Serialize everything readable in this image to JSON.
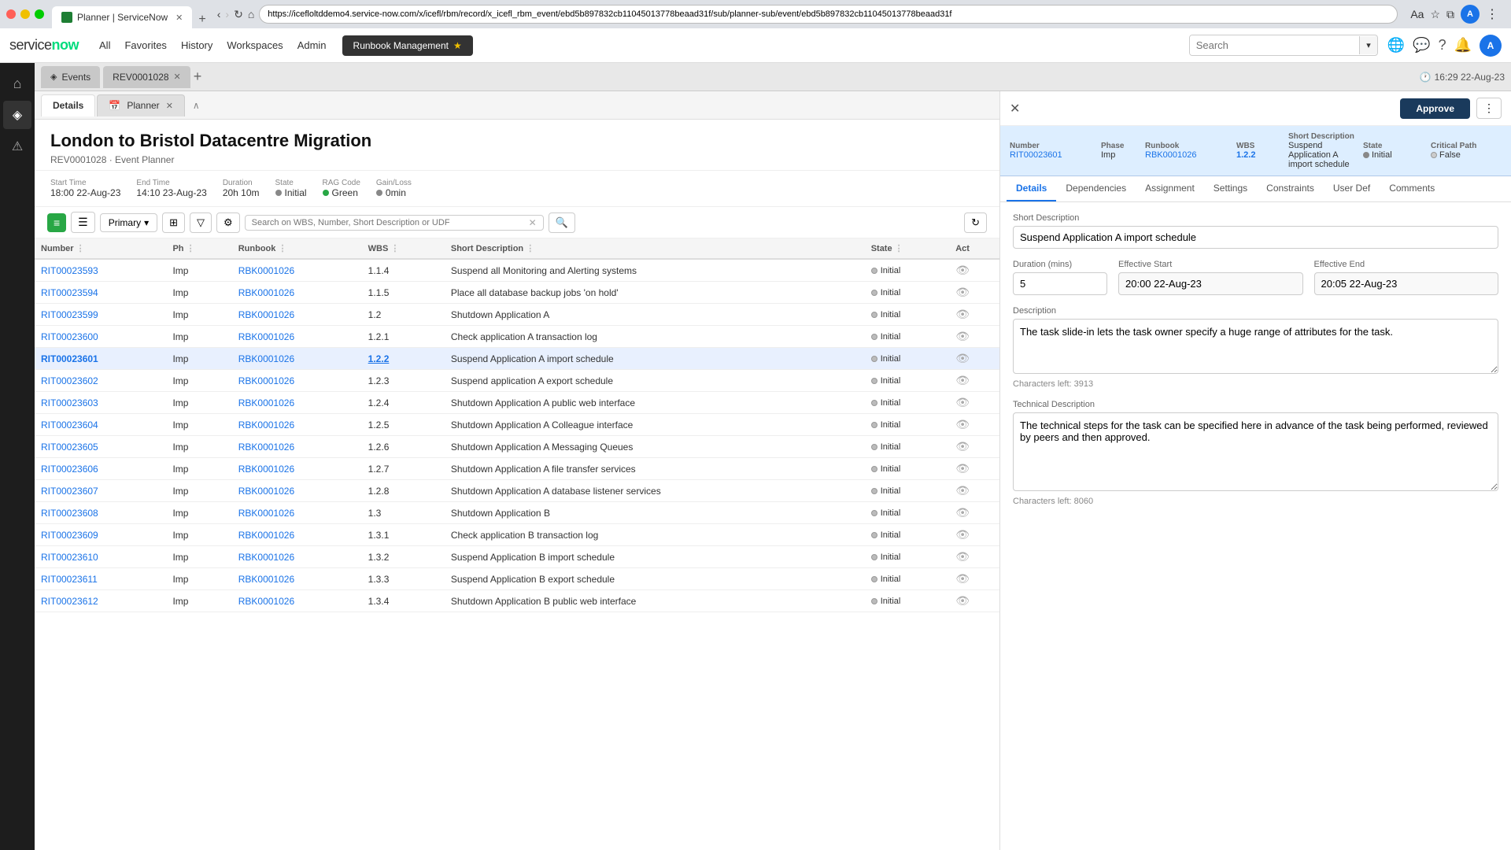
{
  "browser": {
    "tab_label": "Planner | ServiceNow",
    "address": "https://icefloltddemo4.service-now.com/x/icefl/rbm/record/x_icefl_rbm_event/ebd5b897832cb11045013778beaad31f/sub/planner-sub/event/ebd5b897832cb11045013778beaad31f",
    "new_tab_label": "+",
    "minimize": "—",
    "maximize": "□",
    "close": "✕"
  },
  "header": {
    "logo": "servicenow",
    "nav_items": [
      "All",
      "Favorites",
      "History",
      "Workspaces",
      "Admin"
    ],
    "runbook_btn": "Runbook Management",
    "search_placeholder": "Search",
    "clock_icon": "🕐",
    "datetime": "16:29 22-Aug-23"
  },
  "left_sidebar": {
    "icons": [
      {
        "name": "home-icon",
        "symbol": "⌂",
        "active": false
      },
      {
        "name": "tag-icon",
        "symbol": "◈",
        "active": true
      },
      {
        "name": "alert-icon",
        "symbol": "⚠",
        "active": false
      }
    ]
  },
  "tabs": {
    "items": [
      {
        "label": "Events",
        "closeable": false,
        "active": false
      },
      {
        "label": "REV0001028",
        "closeable": true,
        "active": true
      }
    ],
    "add_label": "+"
  },
  "content_tabs": {
    "items": [
      {
        "label": "Details",
        "active": true
      },
      {
        "label": "Planner",
        "closeable": true,
        "active": false
      }
    ]
  },
  "page": {
    "title": "London to Bristol Datacentre Migration",
    "subtitle": "REV0001028 · Event Planner",
    "meta": {
      "start_time_label": "Start Time",
      "start_time": "18:00 22-Aug-23",
      "end_time_label": "End Time",
      "end_time": "14:10 23-Aug-23",
      "duration_label": "Duration",
      "duration": "20h 10m",
      "state_label": "State",
      "state": "Initial",
      "rag_label": "RAG Code",
      "rag": "Green",
      "gain_loss_label": "Gain/Loss",
      "gain_loss": "0min"
    }
  },
  "toolbar": {
    "primary_label": "Primary",
    "search_placeholder": "Search on WBS, Number, Short Description or UDF",
    "refresh_title": "Refresh"
  },
  "table": {
    "columns": [
      "Number",
      "Ph",
      "Runbook",
      "WBS",
      "Short Description",
      "State",
      "Act"
    ],
    "rows": [
      {
        "number": "RIT00023593",
        "ph": "Imp",
        "runbook": "RBK0001026",
        "wbs": "1.1.4",
        "desc": "Suspend all Monitoring and Alerting systems",
        "state": "Initial",
        "selected": false
      },
      {
        "number": "RIT00023594",
        "ph": "Imp",
        "runbook": "RBK0001026",
        "wbs": "1.1.5",
        "desc": "Place all database backup jobs 'on hold'",
        "state": "Initial",
        "selected": false
      },
      {
        "number": "RIT00023599",
        "ph": "Imp",
        "runbook": "RBK0001026",
        "wbs": "1.2",
        "desc": "Shutdown Application A",
        "state": "Initial",
        "selected": false
      },
      {
        "number": "RIT00023600",
        "ph": "Imp",
        "runbook": "RBK0001026",
        "wbs": "1.2.1",
        "desc": "Check application A transaction log",
        "state": "Initial",
        "selected": false
      },
      {
        "number": "RIT00023601",
        "ph": "Imp",
        "runbook": "RBK0001026",
        "wbs": "1.2.2",
        "desc": "Suspend Application A import schedule",
        "state": "Initial",
        "selected": true
      },
      {
        "number": "RIT00023602",
        "ph": "Imp",
        "runbook": "RBK0001026",
        "wbs": "1.2.3",
        "desc": "Suspend application A export schedule",
        "state": "Initial",
        "selected": false
      },
      {
        "number": "RIT00023603",
        "ph": "Imp",
        "runbook": "RBK0001026",
        "wbs": "1.2.4",
        "desc": "Shutdown Application A public web interface",
        "state": "Initial",
        "selected": false
      },
      {
        "number": "RIT00023604",
        "ph": "Imp",
        "runbook": "RBK0001026",
        "wbs": "1.2.5",
        "desc": "Shutdown Application A Colleague interface",
        "state": "Initial",
        "selected": false
      },
      {
        "number": "RIT00023605",
        "ph": "Imp",
        "runbook": "RBK0001026",
        "wbs": "1.2.6",
        "desc": "Shutdown Application A Messaging Queues",
        "state": "Initial",
        "selected": false
      },
      {
        "number": "RIT00023606",
        "ph": "Imp",
        "runbook": "RBK0001026",
        "wbs": "1.2.7",
        "desc": "Shutdown Application A file transfer services",
        "state": "Initial",
        "selected": false
      },
      {
        "number": "RIT00023607",
        "ph": "Imp",
        "runbook": "RBK0001026",
        "wbs": "1.2.8",
        "desc": "Shutdown Application A database listener services",
        "state": "Initial",
        "selected": false
      },
      {
        "number": "RIT00023608",
        "ph": "Imp",
        "runbook": "RBK0001026",
        "wbs": "1.3",
        "desc": "Shutdown Application B",
        "state": "Initial",
        "selected": false
      },
      {
        "number": "RIT00023609",
        "ph": "Imp",
        "runbook": "RBK0001026",
        "wbs": "1.3.1",
        "desc": "Check application B transaction log",
        "state": "Initial",
        "selected": false
      },
      {
        "number": "RIT00023610",
        "ph": "Imp",
        "runbook": "RBK0001026",
        "wbs": "1.3.2",
        "desc": "Suspend Application B import schedule",
        "state": "Initial",
        "selected": false
      },
      {
        "number": "RIT00023611",
        "ph": "Imp",
        "runbook": "RBK0001026",
        "wbs": "1.3.3",
        "desc": "Suspend Application B export schedule",
        "state": "Initial",
        "selected": false
      },
      {
        "number": "RIT00023612",
        "ph": "Imp",
        "runbook": "RBK0001026",
        "wbs": "1.3.4",
        "desc": "Shutdown Application B public web interface",
        "state": "Initial",
        "selected": false
      }
    ]
  },
  "right_panel": {
    "data_row": {
      "number_label": "Number",
      "number_value": "RIT00023601",
      "phase_label": "Phase",
      "phase_value": "Imp",
      "runbook_label": "Runbook",
      "runbook_value": "RBK0001026",
      "wbs_label": "WBS",
      "wbs_value": "1.2.2",
      "short_desc_label": "Short Description",
      "short_desc_value": "Suspend Application A import schedule",
      "state_label": "State",
      "state_value": "Initial",
      "critical_path_label": "Critical Path",
      "critical_path_value": "False"
    },
    "tabs": [
      "Details",
      "Dependencies",
      "Assignment",
      "Settings",
      "Constraints",
      "User Def",
      "Comments"
    ],
    "active_tab": "Details",
    "approve_label": "Approve",
    "form": {
      "short_desc_label": "Short Description",
      "short_desc_value": "Suspend Application A import schedule",
      "duration_label": "Duration (mins)",
      "duration_value": "5",
      "eff_start_label": "Effective Start",
      "eff_start_value": "20:00 22-Aug-23",
      "eff_end_label": "Effective End",
      "eff_end_value": "20:05 22-Aug-23",
      "desc_label": "Description",
      "desc_value": "The task slide-in lets the task owner specify a huge range of attributes for the task.",
      "desc_chars_left": "Characters left: 3913",
      "tech_desc_label": "Technical Description",
      "tech_desc_value": "The technical steps for the task can be specified here in advance of the task being performed, reviewed by peers and then approved.",
      "tech_desc_chars_left": "Characters left: 8060"
    }
  }
}
